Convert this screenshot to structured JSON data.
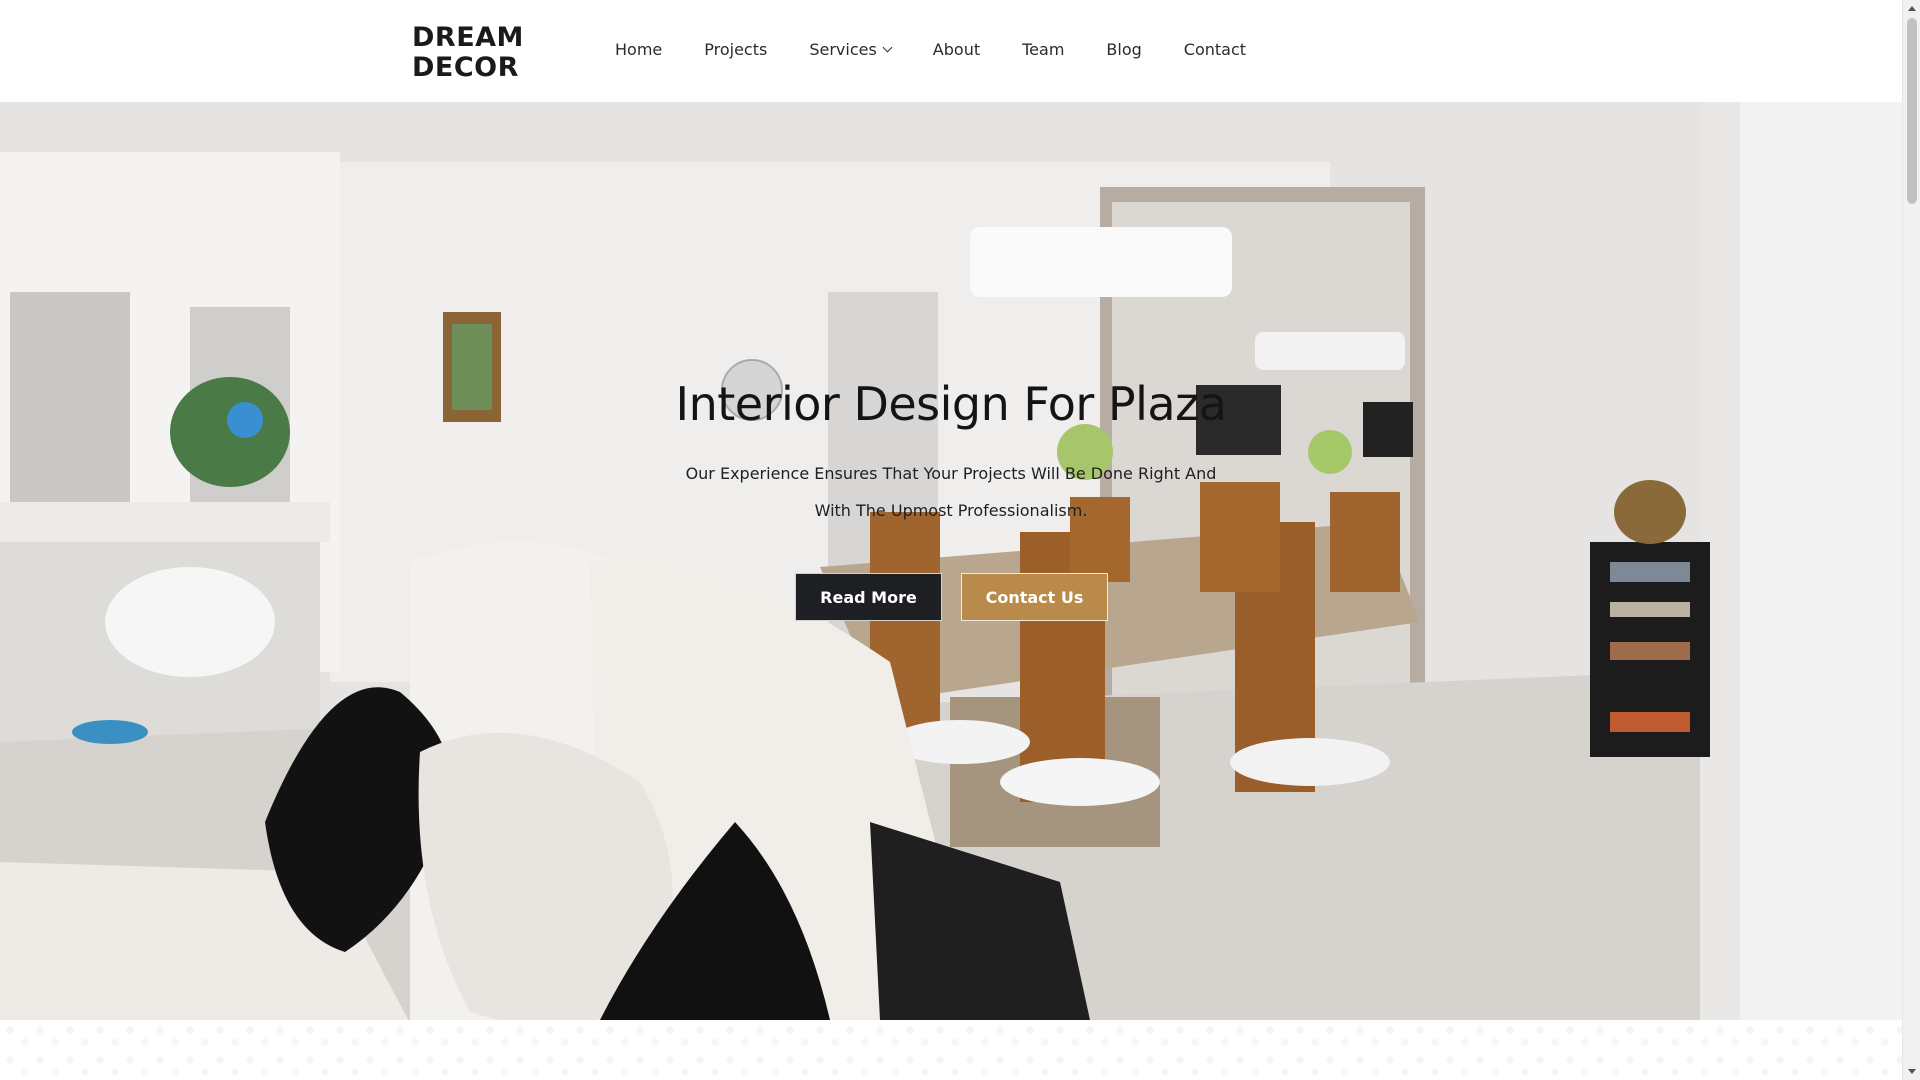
{
  "brand": {
    "line1": "DREAM",
    "line2": "DECOR"
  },
  "nav": {
    "items": [
      {
        "label": "Home",
        "has_dropdown": false
      },
      {
        "label": "Projects",
        "has_dropdown": false
      },
      {
        "label": "Services",
        "has_dropdown": true
      },
      {
        "label": "About",
        "has_dropdown": false
      },
      {
        "label": "Team",
        "has_dropdown": false
      },
      {
        "label": "Blog",
        "has_dropdown": false
      },
      {
        "label": "Contact",
        "has_dropdown": false
      }
    ]
  },
  "hero": {
    "title": "Interior Design For Plaza",
    "subtitle": "Our Experience Ensures That Your Projects Will Be Done Right And With The Upmost Professionalism.",
    "primary_button": "Read More",
    "secondary_button": "Contact Us"
  },
  "colors": {
    "primary_button_bg": "#1d1f22",
    "accent": "#b98a4a",
    "header_bg": "#ffffff",
    "text_dark": "#141414"
  },
  "icons": {
    "dropdown": "chevron-down-icon"
  }
}
